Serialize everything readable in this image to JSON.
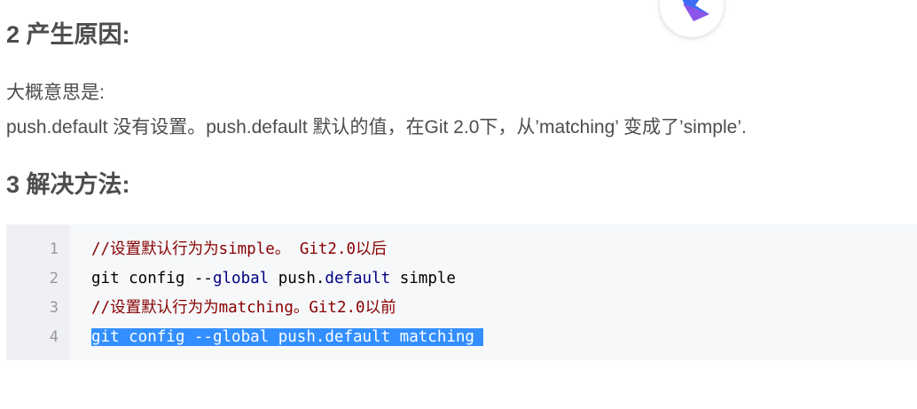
{
  "section2": {
    "heading": "2 产生原因:",
    "intro": "大概意思是:",
    "detail": "push.default 没有设置。push.default 默认的值，在Git 2.0下，从’matching’ 变成了’simple’."
  },
  "section3": {
    "heading": "3 解决方法:"
  },
  "code": {
    "line_numbers": [
      "1",
      "2",
      "3",
      "4"
    ],
    "lines": [
      {
        "comment": "//设置默认行为为simple。 Git2.0以后"
      },
      {
        "prefix": "git config --",
        "kw1": "global",
        "mid": " push.",
        "kw2": "default",
        "suffix": " simple"
      },
      {
        "comment": "//设置默认行为为matching。Git2.0以前"
      },
      {
        "text": "git config --global push.default matching",
        "selected": true
      }
    ]
  },
  "colors": {
    "comment": "#880000",
    "keyword": "#000080",
    "selection": "#338fff",
    "logo_blue": "#3b6ef5",
    "logo_purple": "#8a55e8"
  },
  "icons": {
    "floating_logo": "assistant-logo-icon"
  }
}
